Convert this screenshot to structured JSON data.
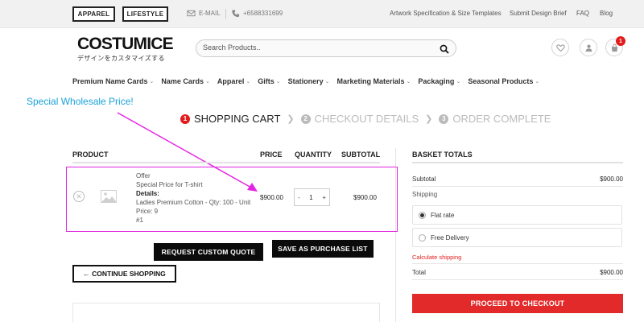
{
  "topbar": {
    "buttons": [
      "APPAREL",
      "LIFESTYLE"
    ],
    "email_label": "E-MAIL",
    "phone": "+6588331699",
    "links": [
      "Artwork Specification & Size Templates",
      "Submit Design Brief",
      "FAQ",
      "Blog"
    ]
  },
  "header": {
    "logo_text": "COSTUMICE",
    "logo_subtext": "デザインをカスタマイズする",
    "search_placeholder": "Search Products..",
    "cart_count": "1"
  },
  "nav": {
    "items": [
      "Premium Name Cards",
      "Name Cards",
      "Apparel",
      "Gifts",
      "Stationery",
      "Marketing Materials",
      "Packaging",
      "Seasonal Products"
    ]
  },
  "annotation": {
    "text": "Special Wholesale Price!",
    "color": "#1aa3d9",
    "arrow_color": "#e325e3"
  },
  "checkout_steps": [
    {
      "num": "1",
      "label": "SHOPPING CART"
    },
    {
      "num": "2",
      "label": "CHECKOUT DETAILS"
    },
    {
      "num": "3",
      "label": "ORDER COMPLETE"
    }
  ],
  "cart": {
    "headers": {
      "product": "PRODUCT",
      "price": "PRICE",
      "quantity": "QUANTITY",
      "subtotal": "SUBTOTAL"
    },
    "item": {
      "line1": "Offer",
      "line2": "Special Price for T-shirt",
      "details_label": "Details:",
      "details": "Ladies Premium Cotton - Qty: 100 - Unit Price: 9",
      "ref": "#1",
      "price": "$900.00",
      "quantity": "1",
      "subtotal": "$900.00"
    },
    "request_quote_label": "REQUEST CUSTOM QUOTE",
    "save_list_label": "SAVE AS PURCHASE LIST",
    "continue_label": "← CONTINUE SHOPPING"
  },
  "basket": {
    "title": "BASKET TOTALS",
    "subtotal_label": "Subtotal",
    "subtotal": "$900.00",
    "shipping_label": "Shipping",
    "shipping_options": [
      "Flat rate",
      "Free Delivery"
    ],
    "calculate_shipping": "Calculate shipping",
    "total_label": "Total",
    "total": "$900.00",
    "checkout_label": "PROCEED TO CHECKOUT",
    "accent": "#e32a2a"
  }
}
